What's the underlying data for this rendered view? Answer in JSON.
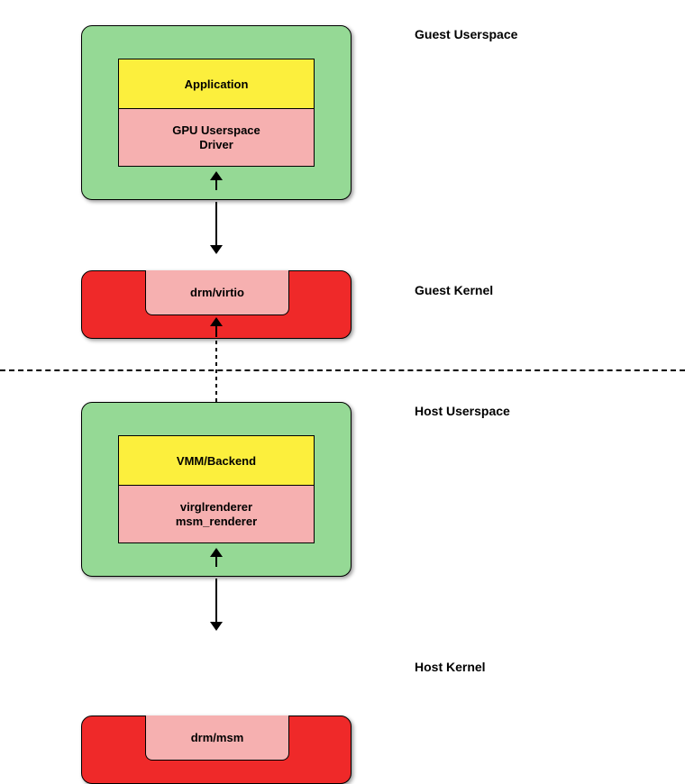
{
  "guestUserspace": {
    "label": "Guest Userspace",
    "application": "Application",
    "driver": "GPU Userspace\nDriver"
  },
  "guestKernel": {
    "label": "Guest Kernel",
    "module": "drm/virtio"
  },
  "hostUserspace": {
    "label": "Host Userspace",
    "vmm": "VMM/Backend",
    "renderer": "virglrenderer\nmsm_renderer"
  },
  "hostKernel": {
    "label": "Host Kernel",
    "module": "drm/msm"
  }
}
